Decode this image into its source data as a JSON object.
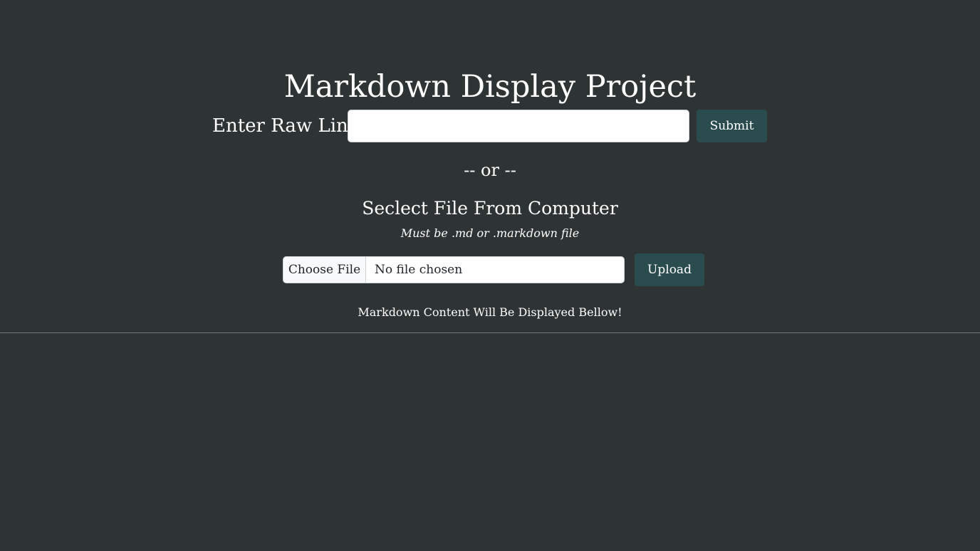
{
  "header": {
    "title": "Markdown Display Project"
  },
  "link_form": {
    "label": "Enter Raw Link",
    "input_value": "",
    "input_placeholder": "",
    "submit_label": "Submit"
  },
  "separator": {
    "text": "-- or --"
  },
  "file_form": {
    "heading": "Seclect File From Computer",
    "hint": "Must be .md or .markdown file",
    "choose_label": "Choose File",
    "status": "No file chosen",
    "upload_label": "Upload"
  },
  "output": {
    "note": "Markdown Content Will Be Displayed Bellow!"
  },
  "colors": {
    "background": "#2e3333",
    "button": "#2b4c4f",
    "text": "#ffffff"
  }
}
